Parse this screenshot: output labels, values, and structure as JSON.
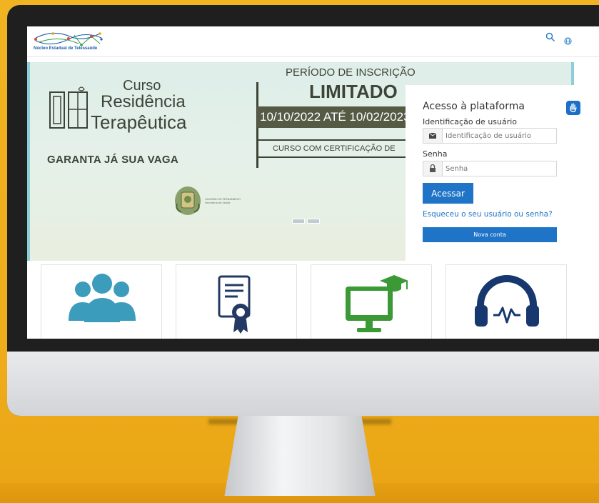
{
  "site": {
    "logo_text": "Núcleo Estadual de Telessaúde"
  },
  "header": {
    "search_icon": "search-icon",
    "language_icon": "globe-icon"
  },
  "banner": {
    "course_line1": "Curso",
    "course_line2": "Residência",
    "course_line3": "Terapêutica",
    "cta": "GARANTA JÁ SUA VAGA",
    "period_label": "PERÍODO DE INSCRIÇÃO",
    "limited": "LIMITADO",
    "dates": "10/10/2022 ATÉ 10/02/2023",
    "certification": "CURSO COM CERTIFICAÇÃO DE",
    "government_text": "GOVERNO DE PERNAMBUCO",
    "government_subtext": "Secretaria de Saúde",
    "slides": 2,
    "active_slide": 1
  },
  "login": {
    "title": "Acesso à plataforma",
    "username_label": "Identificação de usuário",
    "username_placeholder": "Identificação de usuário",
    "password_label": "Senha",
    "password_placeholder": "Senha",
    "submit_label": "Acessar",
    "forgot_link": "Esqueceu o seu usuário ou senha?",
    "new_account_label": "Nova conta"
  },
  "cards": [
    {
      "icon": "people-group-icon"
    },
    {
      "icon": "certificate-icon"
    },
    {
      "icon": "online-course-icon"
    },
    {
      "icon": "headphones-icon"
    }
  ],
  "colors": {
    "background": "#efaf1e",
    "primary": "#1f74c8",
    "banner_text": "#3d4437",
    "card_teal": "#3b9cbc",
    "card_navy": "#243a63",
    "card_green": "#3b9a36",
    "card_dark_blue": "#16386e"
  }
}
